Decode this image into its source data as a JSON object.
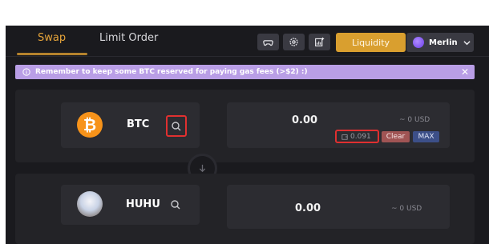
{
  "tabs": {
    "swap": "Swap",
    "limit_order": "Limit Order",
    "active": "swap"
  },
  "toolbar": {
    "icons": [
      "gamepad-icon",
      "gear-icon",
      "chart-add-icon"
    ],
    "liquidity_label": "Liquidity",
    "network_label": "Merlin",
    "accent": "#d99f2f"
  },
  "banner": {
    "text": "Remember to keep some BTC reserved for paying gas fees (>$2) :)",
    "close": "✕",
    "color": "#b99ee6"
  },
  "from": {
    "symbol": "BTC",
    "amount": "0.00",
    "usd": "~ 0 USD",
    "balance": "0.091",
    "clear_label": "Clear",
    "max_label": "MAX",
    "coin_glyph": "₿"
  },
  "to": {
    "symbol": "HUHU",
    "amount": "0.00",
    "usd": "~ 0 USD"
  }
}
